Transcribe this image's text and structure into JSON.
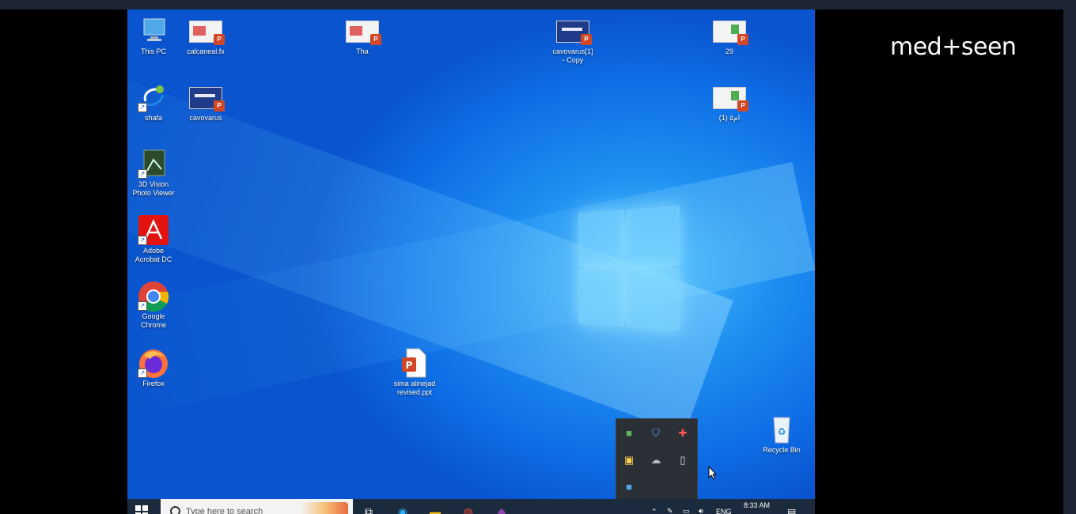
{
  "brand": {
    "text": "med+seen"
  },
  "desktop_icons": [
    {
      "label": "This PC",
      "icon": "computer-icon"
    },
    {
      "label": "calcaneal.fx",
      "icon": "powerpoint-file-icon"
    },
    {
      "label": "Tha",
      "icon": "powerpoint-file-icon"
    },
    {
      "label": "cavovarus[1]\n- Copy",
      "icon": "powerpoint-file-icon"
    },
    {
      "label": "29",
      "icon": "powerpoint-file-icon"
    },
    {
      "label": "shafa",
      "icon": "shafa-app-icon"
    },
    {
      "label": "cavovarus",
      "icon": "powerpoint-file-icon"
    },
    {
      "label": "(1) ۵ام",
      "icon": "powerpoint-file-icon"
    },
    {
      "label": "3D Vision\nPhoto Viewer",
      "icon": "photo-viewer-icon"
    },
    {
      "label": "Adobe\nAcrobat DC",
      "icon": "acrobat-icon"
    },
    {
      "label": "Google\nChrome",
      "icon": "chrome-icon"
    },
    {
      "label": "Firefox",
      "icon": "firefox-icon"
    },
    {
      "label": "sima alinejad\nrevised.ppt",
      "icon": "powerpoint-file-icon"
    },
    {
      "label": "Recycle Bin",
      "icon": "recycle-bin-icon"
    }
  ],
  "tray_popup": {
    "icons": [
      "green-app-icon",
      "defender-icon",
      "shield-cross-icon",
      "security-badge-icon",
      "cloud-off-icon",
      "usb-icon",
      "app-blue-icon"
    ]
  },
  "taskbar": {
    "search_placeholder": "Type here to search",
    "apps": [
      "task-view-icon",
      "edge-icon",
      "file-explorer-icon",
      "chrome-icon",
      "onenote-icon"
    ],
    "language": "ENG",
    "time": "8:33 AM"
  },
  "colors": {
    "desktop_blue": "#0d6ee6",
    "taskbar": "#1c2a3d",
    "brand_text": "#ffffff"
  }
}
